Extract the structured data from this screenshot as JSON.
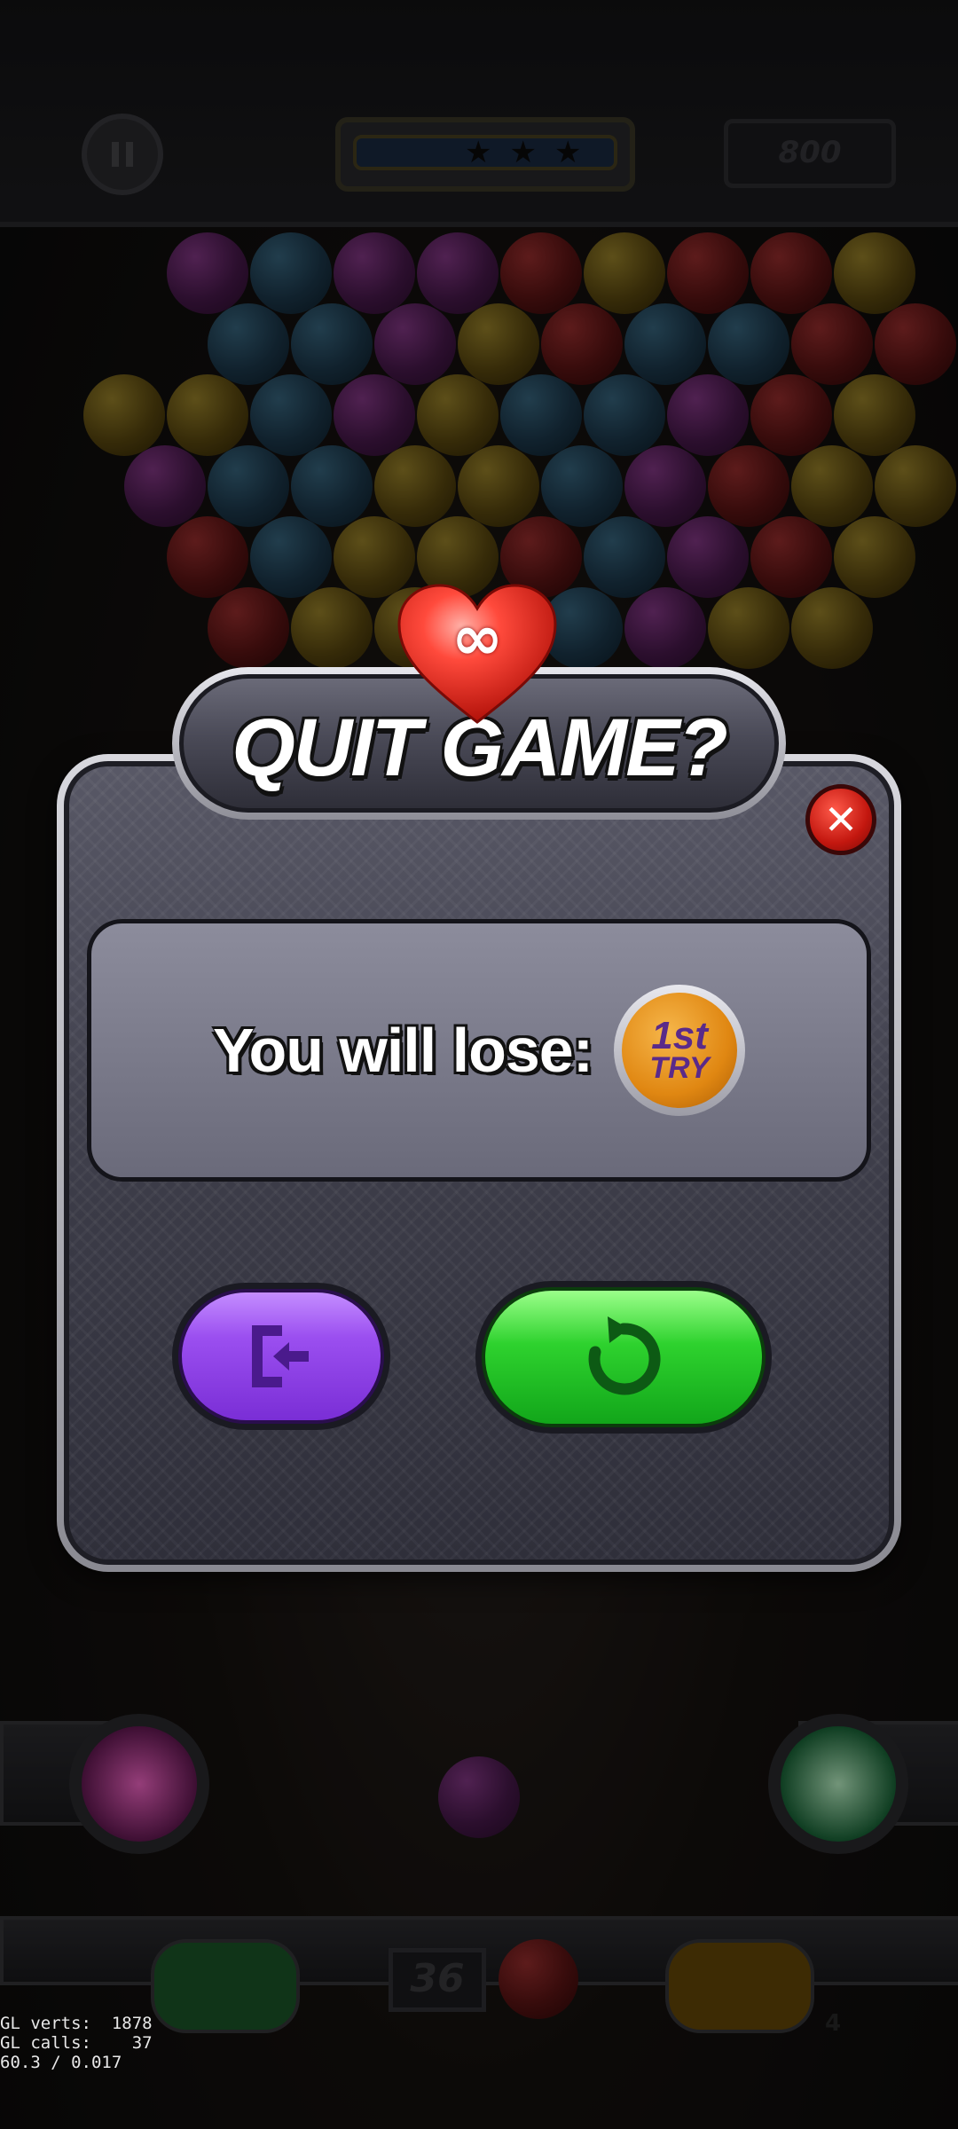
{
  "hud": {
    "score": "800",
    "stars_icon": "star-icons"
  },
  "dialog": {
    "title": "QUIT GAME?",
    "lives_badge": "∞",
    "lose_label": "You will lose:",
    "badge_line1": "1st",
    "badge_line2": "TRY",
    "close_icon": "close-icon",
    "quit_icon": "exit-door-icon",
    "retry_icon": "restart-arrow-icon"
  },
  "launcher": {
    "shots_remaining": "36",
    "booster_count": "4"
  },
  "debug": {
    "line1": "GL verts:  1878",
    "line2": "GL calls:    37",
    "line3": "60.3 / 0.017"
  },
  "colors": {
    "quit_button": "#9b4ff0",
    "retry_button": "#2ed22e",
    "close_button": "#c3170f",
    "badge": "#e08712"
  }
}
